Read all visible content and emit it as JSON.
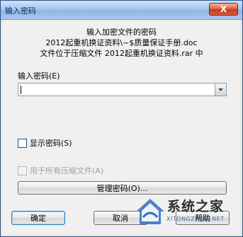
{
  "window": {
    "title": "输入密码",
    "close_label": "X"
  },
  "info": {
    "line1": "输入加密文件的密码",
    "line2": "2012起重机换证资料\\~$质量保证手册.doc",
    "line3": "文件位于压缩文件 2012起重机换证资料.rar 中"
  },
  "password": {
    "label": "输入密码(E)",
    "value": ""
  },
  "options": {
    "show_password": "显示密码(S)",
    "use_for_all": "用于所有压缩文件(A)"
  },
  "buttons": {
    "manage": "管理密码(O)...",
    "ok": "确定",
    "cancel": "取消",
    "help": "帮助"
  },
  "watermark": {
    "text": "系统之家",
    "url": "XITONGZHIJIA.NET"
  },
  "colors": {
    "title_gradient_mid": "#8fb5e6",
    "close_red": "#c8391c",
    "watermark_blue": "#2f6fc0"
  }
}
